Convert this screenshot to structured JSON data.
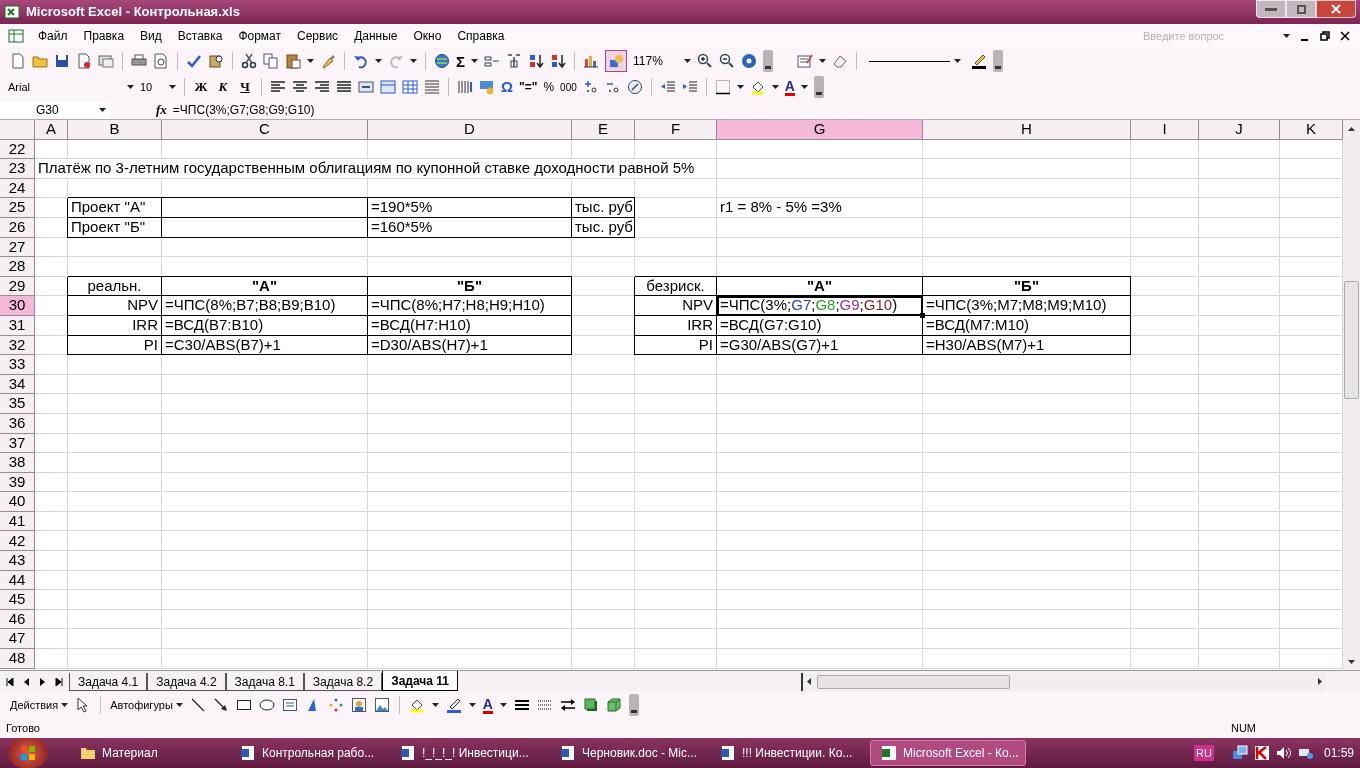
{
  "window": {
    "title": "Microsoft Excel - Контрольная.xls"
  },
  "menu": [
    "Файл",
    "Правка",
    "Вид",
    "Вставка",
    "Формат",
    "Сервис",
    "Данные",
    "Окно",
    "Справка"
  ],
  "help_box": {
    "placeholder": "Введите вопрос"
  },
  "standard_toolbar": {
    "autosum": "Σ",
    "zoom": "117%",
    "drawing_pressed": true
  },
  "formatting_toolbar": {
    "font": "Arial",
    "size": "10",
    "bold": "Ж",
    "italic": "К",
    "underline": "Ч",
    "symbol": "Ω",
    "euro": "\"=\"",
    "percent": "%",
    "thousands": "000",
    "font_color": "A"
  },
  "formula_bar": {
    "name_box": "G30",
    "fx": "fx",
    "formula": "=ЧПС(3%;G7;G8;G9;G10)"
  },
  "columns": [
    {
      "label": "A",
      "selected": false
    },
    {
      "label": "B",
      "selected": false
    },
    {
      "label": "C",
      "selected": false
    },
    {
      "label": "D",
      "selected": false
    },
    {
      "label": "E",
      "selected": false
    },
    {
      "label": "F",
      "selected": false
    },
    {
      "label": "G",
      "selected": true
    },
    {
      "label": "H",
      "selected": false
    },
    {
      "label": "I",
      "selected": false
    },
    {
      "label": "J",
      "selected": false
    },
    {
      "label": "K",
      "selected": false
    }
  ],
  "rows": [
    {
      "number": "22",
      "selected": false
    },
    {
      "number": "23",
      "selected": false,
      "cells": [
        {
          "text": "Платёж по 3-летним государственным облигациям по купонной ставке доходности равной 5%",
          "kind": "text"
        }
      ]
    },
    {
      "number": "24",
      "selected": false
    },
    {
      "number": "25",
      "selected": false,
      "cells": [
        null,
        {
          "text": "Проект \"А\"",
          "kind": "text",
          "boxed": true
        },
        {
          "kind": "text",
          "boxed": true
        },
        {
          "text": "=190*5%",
          "kind": "text",
          "boxed": true
        },
        {
          "text": "тыс. руб",
          "kind": "text",
          "boxed": true
        },
        null,
        {
          "text": "r1 = 8% - 5% =3%",
          "kind": "text"
        }
      ]
    },
    {
      "number": "26",
      "selected": false,
      "cells": [
        null,
        {
          "text": "Проект \"Б\"",
          "kind": "text",
          "boxed": true
        },
        {
          "kind": "text",
          "boxed": true
        },
        {
          "text": "=160*5%",
          "kind": "text",
          "boxed": true
        },
        {
          "text": "тыс. руб",
          "kind": "text",
          "boxed": true
        }
      ]
    },
    {
      "number": "27",
      "selected": false
    },
    {
      "number": "28",
      "selected": false
    },
    {
      "number": "29",
      "selected": false,
      "cells": [
        null,
        {
          "text": "реальн.",
          "kind": "center",
          "boxed": true
        },
        {
          "text": "\"А\"",
          "kind": "header",
          "boxed": true
        },
        {
          "text": "\"Б\"",
          "kind": "header",
          "boxed": true
        },
        null,
        {
          "text": "безриск.",
          "kind": "center",
          "boxed": true
        },
        {
          "text": "\"А\"",
          "kind": "header",
          "boxed": true
        },
        {
          "text": "\"Б\"",
          "kind": "header",
          "boxed": true
        }
      ]
    },
    {
      "number": "30",
      "selected": true,
      "cells": [
        null,
        {
          "text": "NPV",
          "kind": "label",
          "boxed": true
        },
        {
          "text": "=ЧПС(8%;B7;B8;B9;B10)",
          "kind": "text",
          "boxed": true
        },
        {
          "text": "=ЧПС(8%;H7;H8;H9;H10)",
          "kind": "text",
          "boxed": true
        },
        null,
        {
          "text": "NPV",
          "kind": "label",
          "boxed": true
        },
        {
          "kind": "text",
          "boxed": true,
          "selected": true,
          "parts": [
            {
              "text": "=ЧПС(3%;",
              "color": "#000000"
            },
            {
              "text": "G7",
              "color": "#2b3bd6"
            },
            {
              "text": ";",
              "color": "#000000"
            },
            {
              "text": "G8",
              "color": "#2e9a2e"
            },
            {
              "text": ";",
              "color": "#000000"
            },
            {
              "text": "G9",
              "color": "#9a2ea8"
            },
            {
              "text": ";",
              "color": "#000000"
            },
            {
              "text": "G10",
              "color": "#8a1c1c"
            },
            {
              "text": ")",
              "color": "#000000"
            }
          ]
        },
        {
          "text": "=ЧПС(3%;M7;M8;M9;M10)",
          "kind": "text",
          "boxed": true
        }
      ]
    },
    {
      "number": "31",
      "selected": false,
      "cells": [
        null,
        {
          "text": "IRR",
          "kind": "label",
          "boxed": true
        },
        {
          "text": "=ВСД(B7:B10)",
          "kind": "text",
          "boxed": true
        },
        {
          "text": "=ВСД(H7:H10)",
          "kind": "text",
          "boxed": true
        },
        null,
        {
          "text": "IRR",
          "kind": "label",
          "boxed": true
        },
        {
          "text": "=ВСД(G7:G10)",
          "kind": "text",
          "boxed": true
        },
        {
          "text": "=ВСД(M7:M10)",
          "kind": "text",
          "boxed": true
        }
      ]
    },
    {
      "number": "32",
      "selected": false,
      "cells": [
        null,
        {
          "text": "PI",
          "kind": "label",
          "boxed": true
        },
        {
          "text": "=C30/ABS(B7)+1",
          "kind": "text",
          "boxed": true
        },
        {
          "text": "=D30/ABS(H7)+1",
          "kind": "text",
          "boxed": true
        },
        null,
        {
          "text": "PI",
          "kind": "label",
          "boxed": true
        },
        {
          "text": "=G30/ABS(G7)+1",
          "kind": "text",
          "boxed": true
        },
        {
          "text": "=H30/ABS(M7)+1",
          "kind": "text",
          "boxed": true
        }
      ]
    },
    {
      "number": "33",
      "selected": false
    },
    {
      "number": "34",
      "selected": false
    },
    {
      "number": "35",
      "selected": false
    },
    {
      "number": "36",
      "selected": false
    },
    {
      "number": "37",
      "selected": false
    },
    {
      "number": "38",
      "selected": false
    },
    {
      "number": "39",
      "selected": false
    },
    {
      "number": "40",
      "selected": false
    },
    {
      "number": "41",
      "selected": false
    },
    {
      "number": "42",
      "selected": false
    },
    {
      "number": "43",
      "selected": false
    },
    {
      "number": "44",
      "selected": false
    },
    {
      "number": "45",
      "selected": false
    },
    {
      "number": "46",
      "selected": false
    },
    {
      "number": "47",
      "selected": false
    },
    {
      "number": "48",
      "selected": false
    }
  ],
  "sheet_tabs": [
    {
      "label": "Задача 4.1",
      "selected": false
    },
    {
      "label": "Задача 4.2",
      "selected": false
    },
    {
      "label": "Задача 8.1",
      "selected": false
    },
    {
      "label": "Задача 8.2",
      "selected": false
    },
    {
      "label": "Задача 11",
      "selected": true
    }
  ],
  "drawing_toolbar": {
    "actions": "Действия",
    "autoshapes": "Автофигуры",
    "font_color": "A"
  },
  "status_bar": {
    "text": "Готово",
    "num": "NUM"
  },
  "taskbar": {
    "items": [
      {
        "label": "Материал",
        "kind": "folder",
        "selected": false
      },
      {
        "label": "Контрольная рабо...",
        "kind": "word",
        "selected": false
      },
      {
        "label": "!_!_!_! Инвестици...",
        "kind": "word",
        "selected": false
      },
      {
        "label": "Черновик.doc - Mic...",
        "kind": "word",
        "selected": false
      },
      {
        "label": "!!! Инвестиции. Ко...",
        "kind": "word",
        "selected": false
      },
      {
        "label": "Microsoft Excel - Ко...",
        "kind": "excel",
        "selected": true
      }
    ],
    "language": "RU",
    "clock": "01:59"
  }
}
